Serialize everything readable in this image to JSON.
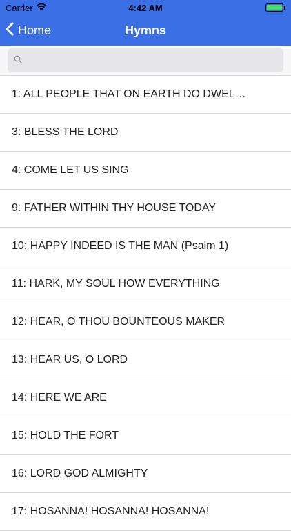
{
  "status_bar": {
    "carrier": "Carrier",
    "time": "4:42 AM",
    "battery_level": 1.0,
    "battery_color": "#4cd964"
  },
  "nav": {
    "back_label": "Home",
    "title": "Hymns",
    "background_color": "#3b6fe6"
  },
  "search": {
    "placeholder": "",
    "value": ""
  },
  "hymns": [
    "1: ALL PEOPLE THAT ON EARTH DO DWEL…",
    "3: BLESS THE LORD",
    "4: COME LET US SING",
    "9: FATHER WITHIN THY HOUSE TODAY",
    "10: HAPPY INDEED IS THE MAN (Psalm 1)",
    "11: HARK, MY SOUL HOW EVERYTHING",
    "12: HEAR, O THOU BOUNTEOUS MAKER",
    "13: HEAR US, O LORD",
    "14: HERE WE ARE",
    "15: HOLD THE FORT",
    "16: LORD GOD ALMIGHTY",
    "17: HOSANNA! HOSANNA! HOSANNA!"
  ]
}
